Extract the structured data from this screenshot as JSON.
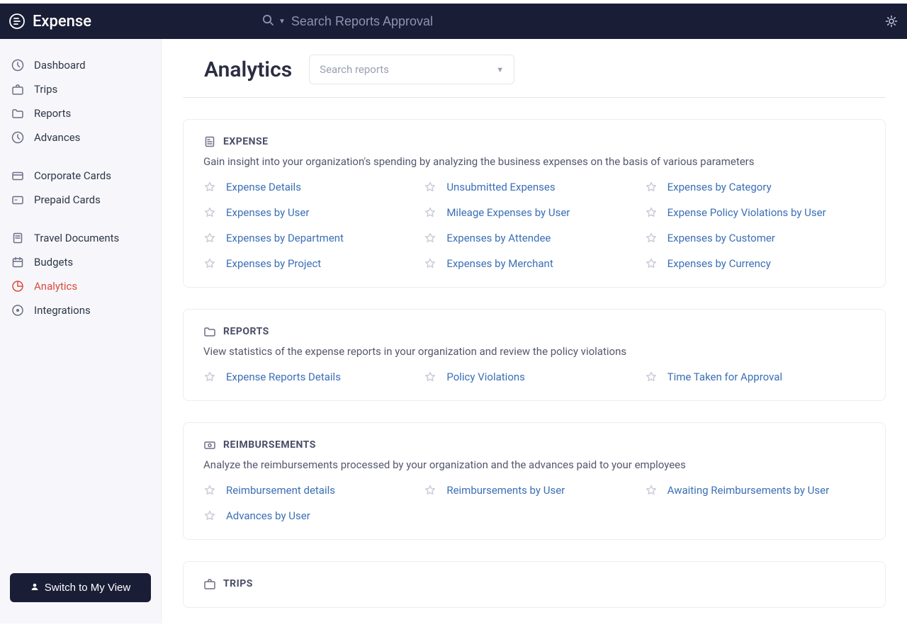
{
  "brand": {
    "name": "Expense"
  },
  "topbar": {
    "search_placeholder": "Search Reports Approval"
  },
  "sidebar": {
    "items": [
      {
        "label": "Dashboard",
        "icon": "clock-icon",
        "active": false
      },
      {
        "label": "Trips",
        "icon": "briefcase-icon",
        "active": false
      },
      {
        "label": "Reports",
        "icon": "folder-icon",
        "active": false
      },
      {
        "label": "Advances",
        "icon": "clock-icon",
        "active": false
      },
      {
        "label": "Corporate Cards",
        "icon": "card-icon",
        "active": false
      },
      {
        "label": "Prepaid Cards",
        "icon": "card-alt-icon",
        "active": false
      },
      {
        "label": "Travel Documents",
        "icon": "document-icon",
        "active": false
      },
      {
        "label": "Budgets",
        "icon": "calendar-icon",
        "active": false
      },
      {
        "label": "Analytics",
        "icon": "pie-icon",
        "active": true
      },
      {
        "label": "Integrations",
        "icon": "integration-icon",
        "active": false
      }
    ],
    "switch_button": "Switch to My View"
  },
  "page": {
    "title": "Analytics",
    "search_reports_placeholder": "Search reports"
  },
  "sections": [
    {
      "key": "expense",
      "title": "EXPENSE",
      "icon": "receipt-icon",
      "description": "Gain insight into your organization's spending by analyzing the business expenses on the basis of various parameters",
      "reports": [
        "Expense Details",
        "Unsubmitted Expenses",
        "Expenses by Category",
        "Expenses by User",
        "Mileage Expenses by User",
        "Expense Policy Violations by User",
        "Expenses by Department",
        "Expenses by Attendee",
        "Expenses by Customer",
        "Expenses by Project",
        "Expenses by Merchant",
        "Expenses by Currency"
      ]
    },
    {
      "key": "reports",
      "title": "REPORTS",
      "icon": "folder-icon",
      "description": "View statistics of the expense reports in your organization and review the policy violations",
      "reports": [
        "Expense Reports Details",
        "Policy Violations",
        "Time Taken for Approval"
      ]
    },
    {
      "key": "reimbursements",
      "title": "REIMBURSEMENTS",
      "icon": "money-icon",
      "description": "Analyze the reimbursements processed by your organization and the advances paid to your employees",
      "reports": [
        "Reimbursement details",
        "Reimbursements by User",
        "Awaiting Reimbursements by User",
        "Advances by User"
      ]
    },
    {
      "key": "trips",
      "title": "TRIPS",
      "icon": "briefcase-icon",
      "description": "",
      "reports": []
    }
  ]
}
